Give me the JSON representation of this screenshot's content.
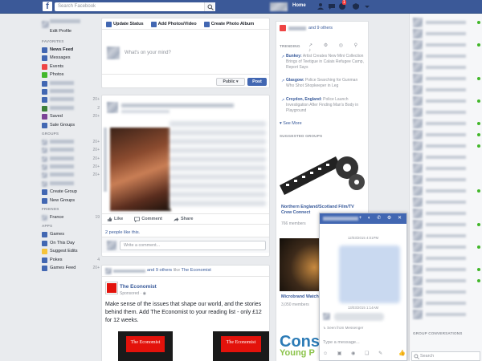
{
  "topbar": {
    "logo": "f",
    "search_placeholder": "Search Facebook",
    "home_label": "Home",
    "notification_count": "1"
  },
  "left_nav": {
    "edit_profile": "Edit Profile",
    "favorites_header": "FAVORITES",
    "favorites": [
      {
        "label": "News Feed",
        "count": "",
        "icon_color": "#4267b2",
        "bold": true
      },
      {
        "label": "Messages",
        "count": "",
        "icon_color": "#4267b2"
      },
      {
        "label": "Events",
        "count": "",
        "icon_color": "#e44"
      },
      {
        "label": "Photos",
        "count": "",
        "icon_color": "#42b72a"
      },
      {
        "label": "",
        "count": "",
        "icon_color": "#4267b2"
      },
      {
        "label": "",
        "count": "",
        "icon_color": "#4267b2"
      },
      {
        "label": "",
        "count": "20+",
        "icon_color": "#4267b2"
      },
      {
        "label": "",
        "count": "2",
        "icon_color": "#3d7f3a"
      },
      {
        "label": "Saved",
        "count": "20+",
        "icon_color": "#7b4397"
      },
      {
        "label": "Sale Groups",
        "count": "",
        "icon_color": "#4267b2"
      }
    ],
    "groups_header": "GROUPS",
    "groups": [
      {
        "label": "",
        "count": "20+"
      },
      {
        "label": "",
        "count": "20+"
      },
      {
        "label": "",
        "count": "20+"
      },
      {
        "label": "",
        "count": "20+"
      },
      {
        "label": "",
        "count": "20+"
      },
      {
        "label": "",
        "count": ""
      }
    ],
    "create_group": "Create Group",
    "new_groups": "New Groups",
    "friends_header": "FRIENDS",
    "friends": [
      {
        "label": "France",
        "count": "19"
      }
    ],
    "apps_header": "APPS",
    "apps": [
      {
        "label": "Games",
        "count": "",
        "icon_color": "#4267b2"
      },
      {
        "label": "On This Day",
        "count": "",
        "icon_color": "#4267b2"
      },
      {
        "label": "Suggest Edits",
        "count": "",
        "icon_color": "#f5c33b"
      },
      {
        "label": "Pokes",
        "count": "4",
        "icon_color": "#4267b2"
      },
      {
        "label": "Games Feed",
        "count": "20+",
        "icon_color": "#4267b2"
      }
    ]
  },
  "composer": {
    "tabs": [
      "Update Status",
      "Add Photos/Video",
      "Create Photo Album"
    ],
    "placeholder": "What's on your mind?",
    "privacy": "Public ▾",
    "post_button": "Post"
  },
  "post1": {
    "actions": [
      "Like",
      "Comment",
      "Share"
    ],
    "likes_text": "2 people like this.",
    "comment_placeholder": "Write a comment..."
  },
  "post2": {
    "liked_by_suffix": "and 9 others",
    "liked_by_verb": "like",
    "liked_page": "The Economist",
    "page_name": "The Economist",
    "sponsored": "Sponsored · ",
    "body": "Make sense of the issues that shape our world, and the stories behind them. Add The Economist to your reading list - only £12 for 12 weeks.",
    "book1_title": "The Economist",
    "book2_title": "The Economist"
  },
  "right_column": {
    "others_text": "and 9 others",
    "trending_header": "TRENDING",
    "trending_icons": "↗ ⚙ ◎ ⚲ ♪",
    "trends": [
      {
        "name": "Bunkey:",
        "desc": "Artist Creates New Mini Collection Brings of Teetigue in Calais Refugee Camp, Report Says"
      },
      {
        "name": "Glasgow:",
        "desc": "Police Searching for Gunman Who Shot Shopkeeper in Leg"
      },
      {
        "name": "Croydon, England:",
        "desc": "Police Launch Investigation After Finding Man's Body in Playground"
      }
    ],
    "see_more": "See More",
    "suggested_header": "SUGGESTED GROUPS",
    "group1_name": "Northern England/Scotland Film/TV Crew Connect",
    "group1_members": "766 members",
    "group2_name": "Microbrand Watch",
    "group2_members": "3,050 members",
    "ad_text": "Conse",
    "ad_text2": "Young P"
  },
  "chat": {
    "group_conversations": "GROUP CONVERSATIONS",
    "search_placeholder": "Search",
    "online_rows": [
      0,
      2,
      5,
      7,
      9,
      10,
      11,
      15,
      18,
      20,
      22,
      23
    ]
  },
  "chat_window": {
    "icons": "+ ◐ ✆ ⚙ ✕",
    "timestamp1": "12/03/2015 4:01PM",
    "timestamp2": "13/03/2015 1:14AM",
    "seen": "Seen from Messenger",
    "input_placeholder": "Type a message...",
    "tools": "☺ ▣ ◉ ❑ ✎",
    "like_icon": "👍"
  }
}
